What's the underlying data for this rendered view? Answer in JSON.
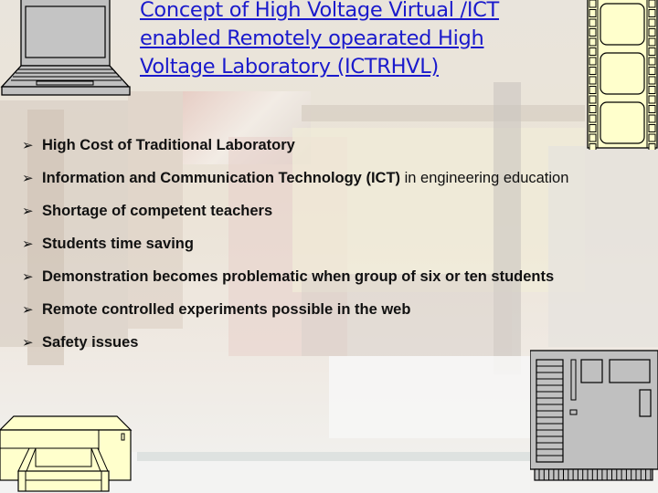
{
  "slide": {
    "title": "Concept of High Voltage Virtual /ICT enabled Remotely opearated High Voltage  Laboratory (ICTRHVL)",
    "title_lines": [
      "Concept of High Voltage Virtual /ICT",
      "enabled Remotely opearated High",
      "Voltage  Laboratory (ICTRHVL)"
    ],
    "title_color": "#1a1acc",
    "bullet_glyph": "➢",
    "bullets": [
      {
        "bold": "High Cost of Traditional Laboratory",
        "rest": ""
      },
      {
        "bold": "Information and Communication Technology (ICT)",
        "rest": " in engineering education"
      },
      {
        "bold": "Shortage of competent teachers",
        "rest": ""
      },
      {
        "bold": "Students time saving",
        "rest": ""
      },
      {
        "bold": "Demonstration becomes problematic when group of six or ten students",
        "rest": ""
      },
      {
        "bold": "Remote controlled experiments possible in the web",
        "rest": ""
      },
      {
        "bold": "Safety issues",
        "rest": ""
      }
    ],
    "clipart": {
      "top_left": "laptop-icon",
      "top_right": "film-strip-icon",
      "bottom_left": "printer-icon",
      "bottom_right": "circuit-board-icon"
    },
    "colors": {
      "clip_gray": "#c0c0c0",
      "clip_cream": "#ffffcc"
    }
  }
}
